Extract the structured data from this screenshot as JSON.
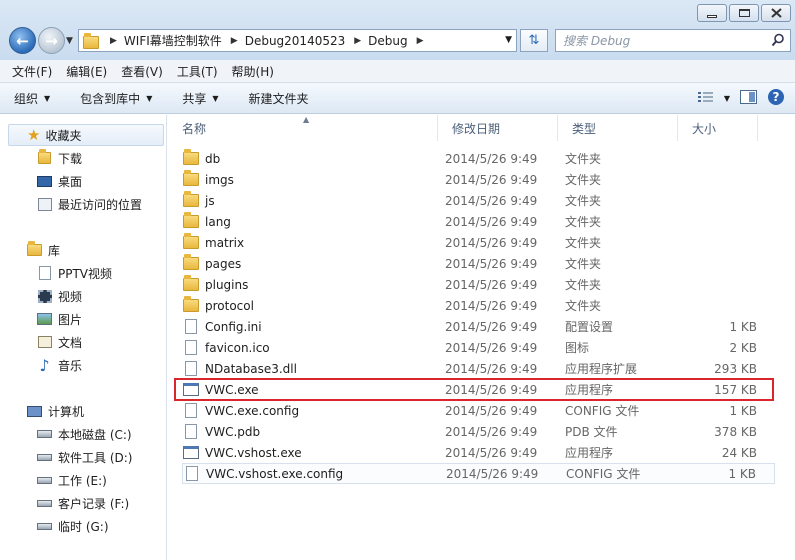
{
  "window": {
    "breadcrumbs": [
      "WIFI幕墙控制软件",
      "Debug20140523",
      "Debug"
    ],
    "search_placeholder": "搜索 Debug"
  },
  "menu": [
    "文件(F)",
    "编辑(E)",
    "查看(V)",
    "工具(T)",
    "帮助(H)"
  ],
  "toolbar": {
    "organize": "组织",
    "include_library": "包含到库中",
    "share": "共享",
    "new_folder": "新建文件夹"
  },
  "nav": {
    "favorites": "收藏夹",
    "favorites_items": [
      "下载",
      "桌面",
      "最近访问的位置"
    ],
    "libraries": "库",
    "libraries_items": [
      "PPTV视频",
      "视频",
      "图片",
      "文档",
      "音乐"
    ],
    "computer": "计算机",
    "computer_items": [
      "本地磁盘 (C:)",
      "软件工具 (D:)",
      "工作 (E:)",
      "客户记录 (F:)",
      "临时 (G:)"
    ]
  },
  "columns": {
    "name": "名称",
    "date": "修改日期",
    "type": "类型",
    "size": "大小"
  },
  "files": [
    {
      "name": "db",
      "date": "2014/5/26 9:49",
      "type": "文件夹",
      "size": "",
      "icon": "folder"
    },
    {
      "name": "imgs",
      "date": "2014/5/26 9:49",
      "type": "文件夹",
      "size": "",
      "icon": "folder"
    },
    {
      "name": "js",
      "date": "2014/5/26 9:49",
      "type": "文件夹",
      "size": "",
      "icon": "folder"
    },
    {
      "name": "lang",
      "date": "2014/5/26 9:49",
      "type": "文件夹",
      "size": "",
      "icon": "folder"
    },
    {
      "name": "matrix",
      "date": "2014/5/26 9:49",
      "type": "文件夹",
      "size": "",
      "icon": "folder"
    },
    {
      "name": "pages",
      "date": "2014/5/26 9:49",
      "type": "文件夹",
      "size": "",
      "icon": "folder"
    },
    {
      "name": "plugins",
      "date": "2014/5/26 9:49",
      "type": "文件夹",
      "size": "",
      "icon": "folder"
    },
    {
      "name": "protocol",
      "date": "2014/5/26 9:49",
      "type": "文件夹",
      "size": "",
      "icon": "folder"
    },
    {
      "name": "Config.ini",
      "date": "2014/5/26 9:49",
      "type": "配置设置",
      "size": "1 KB",
      "icon": "config"
    },
    {
      "name": "favicon.ico",
      "date": "2014/5/26 9:49",
      "type": "图标",
      "size": "2 KB",
      "icon": "doc"
    },
    {
      "name": "NDatabase3.dll",
      "date": "2014/5/26 9:49",
      "type": "应用程序扩展",
      "size": "293 KB",
      "icon": "dll"
    },
    {
      "name": "VWC.exe",
      "date": "2014/5/26 9:49",
      "type": "应用程序",
      "size": "157 KB",
      "icon": "exe"
    },
    {
      "name": "VWC.exe.config",
      "date": "2014/5/26 9:49",
      "type": "CONFIG 文件",
      "size": "1 KB",
      "icon": "doc"
    },
    {
      "name": "VWC.pdb",
      "date": "2014/5/26 9:49",
      "type": "PDB 文件",
      "size": "378 KB",
      "icon": "doc"
    },
    {
      "name": "VWC.vshost.exe",
      "date": "2014/5/26 9:49",
      "type": "应用程序",
      "size": "24 KB",
      "icon": "exe"
    },
    {
      "name": "VWC.vshost.exe.config",
      "date": "2014/5/26 9:49",
      "type": "CONFIG 文件",
      "size": "1 KB",
      "icon": "doc"
    }
  ]
}
